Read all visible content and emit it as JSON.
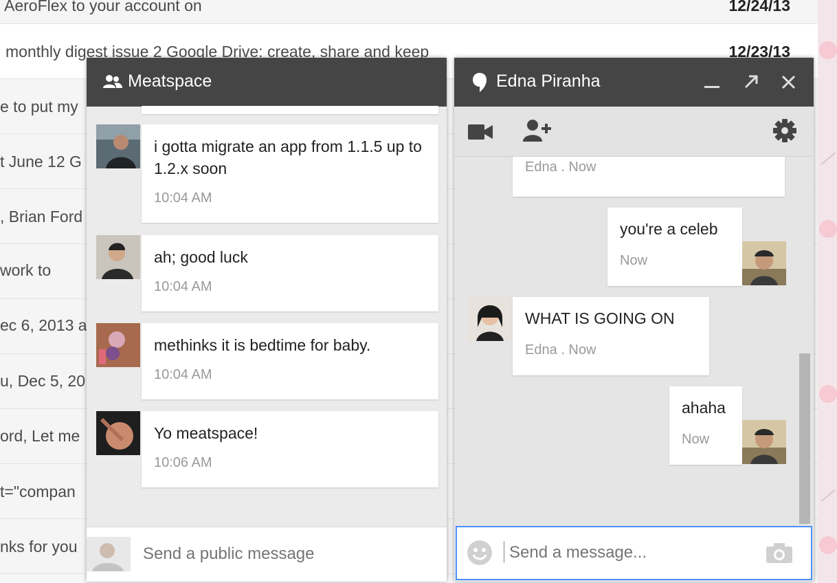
{
  "inbox": {
    "rows": [
      {
        "snippet": "AeroFlex  to your account on",
        "date": "12/24/13"
      },
      {
        "snippet": "monthly digest issue 2 Google Drive: create, share and keep",
        "date": "12/23/13"
      },
      {
        "snippet": "e to put my",
        "date": ""
      },
      {
        "snippet": "t June 12 G",
        "date": ""
      },
      {
        "snippet": ", Brian Ford",
        "date": ""
      },
      {
        "snippet": "work to",
        "date": ""
      },
      {
        "snippet": "ec 6, 2013 a",
        "date": ""
      },
      {
        "snippet": "u, Dec 5, 20",
        "date": ""
      },
      {
        "snippet": "ord, Let me",
        "date": ""
      },
      {
        "snippet": "t=\"compan",
        "date": ""
      },
      {
        "snippet": "nks for you",
        "date": ""
      }
    ]
  },
  "meatspace": {
    "title": "Meatspace",
    "messages": [
      {
        "text": "i gotta migrate an app from 1.1.5 up to 1.2.x soon",
        "time": "10:04 AM"
      },
      {
        "text": "ah; good luck",
        "time": "10:04 AM"
      },
      {
        "text": "methinks it is bedtime for baby.",
        "time": "10:04 AM"
      },
      {
        "text": "Yo meatspace!",
        "time": "10:06 AM"
      }
    ],
    "input_placeholder": "Send a public message"
  },
  "edna": {
    "title": "Edna Piranha",
    "messages": [
      {
        "text": "",
        "author": "Edna",
        "time": "Now"
      },
      {
        "text": "you're a celeb",
        "time": "Now"
      },
      {
        "text": "WHAT IS GOING ON",
        "author": "Edna",
        "time": "Now"
      },
      {
        "text": "ahaha",
        "time": "Now"
      }
    ],
    "input_placeholder": "Send a message..."
  },
  "colors": {
    "header": "#454545",
    "accent": "#4d90fe",
    "panel": "#ebebeb"
  },
  "icons": [
    "people-icon",
    "hangout-bubble-icon",
    "minimize-icon",
    "popout-icon",
    "close-icon",
    "video-icon",
    "add-person-icon",
    "gear-icon",
    "emoji-icon",
    "camera-icon"
  ]
}
